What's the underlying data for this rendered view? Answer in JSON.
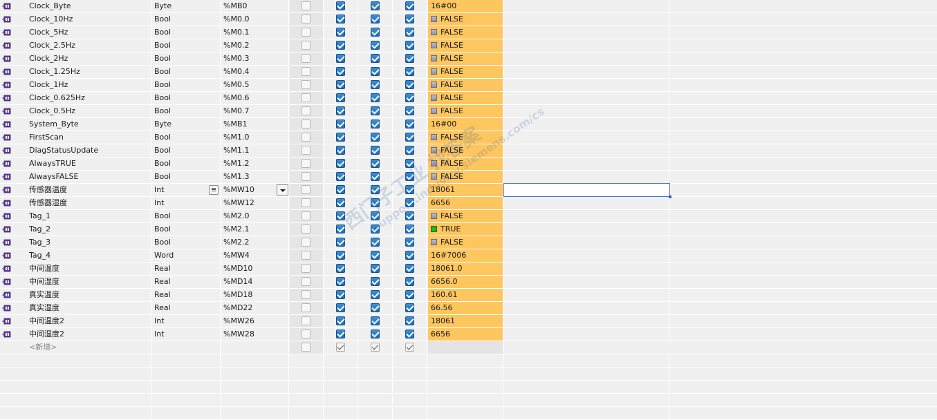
{
  "rows": [
    {
      "name": "Clock_Byte",
      "type": "Byte",
      "address": "%MB0",
      "monitor": "16#00",
      "bool": null
    },
    {
      "name": "Clock_10Hz",
      "type": "Bool",
      "address": "%M0.0",
      "monitor": "FALSE",
      "bool": "false"
    },
    {
      "name": "Clock_5Hz",
      "type": "Bool",
      "address": "%M0.1",
      "monitor": "FALSE",
      "bool": "false"
    },
    {
      "name": "Clock_2.5Hz",
      "type": "Bool",
      "address": "%M0.2",
      "monitor": "FALSE",
      "bool": "false"
    },
    {
      "name": "Clock_2Hz",
      "type": "Bool",
      "address": "%M0.3",
      "monitor": "FALSE",
      "bool": "false"
    },
    {
      "name": "Clock_1.25Hz",
      "type": "Bool",
      "address": "%M0.4",
      "monitor": "FALSE",
      "bool": "false"
    },
    {
      "name": "Clock_1Hz",
      "type": "Bool",
      "address": "%M0.5",
      "monitor": "FALSE",
      "bool": "false"
    },
    {
      "name": "Clock_0.625Hz",
      "type": "Bool",
      "address": "%M0.6",
      "monitor": "FALSE",
      "bool": "false"
    },
    {
      "name": "Clock_0.5Hz",
      "type": "Bool",
      "address": "%M0.7",
      "monitor": "FALSE",
      "bool": "false"
    },
    {
      "name": "System_Byte",
      "type": "Byte",
      "address": "%MB1",
      "monitor": "16#00",
      "bool": null
    },
    {
      "name": "FirstScan",
      "type": "Bool",
      "address": "%M1.0",
      "monitor": "FALSE",
      "bool": "false"
    },
    {
      "name": "DiagStatusUpdate",
      "type": "Bool",
      "address": "%M1.1",
      "monitor": "FALSE",
      "bool": "false"
    },
    {
      "name": "AlwaysTRUE",
      "type": "Bool",
      "address": "%M1.2",
      "monitor": "FALSE",
      "bool": "false"
    },
    {
      "name": "AlwaysFALSE",
      "type": "Bool",
      "address": "%M1.3",
      "monitor": "FALSE",
      "bool": "false"
    },
    {
      "name": "传感器温度",
      "type": "Int",
      "address": "%MW10",
      "monitor": "18061",
      "bool": null
    },
    {
      "name": "传感器湿度",
      "type": "Int",
      "address": "%MW12",
      "monitor": "6656",
      "bool": null
    },
    {
      "name": "Tag_1",
      "type": "Bool",
      "address": "%M2.0",
      "monitor": "FALSE",
      "bool": "false"
    },
    {
      "name": "Tag_2",
      "type": "Bool",
      "address": "%M2.1",
      "monitor": "TRUE",
      "bool": "true"
    },
    {
      "name": "Tag_3",
      "type": "Bool",
      "address": "%M2.2",
      "monitor": "FALSE",
      "bool": "false"
    },
    {
      "name": "Tag_4",
      "type": "Word",
      "address": "%MW4",
      "monitor": "16#7006",
      "bool": null
    },
    {
      "name": "中间温度",
      "type": "Real",
      "address": "%MD10",
      "monitor": "18061.0",
      "bool": null
    },
    {
      "name": "中间湿度",
      "type": "Real",
      "address": "%MD14",
      "monitor": "6656.0",
      "bool": null
    },
    {
      "name": "真实温度",
      "type": "Real",
      "address": "%MD18",
      "monitor": "160.61",
      "bool": null
    },
    {
      "name": "真实湿度",
      "type": "Real",
      "address": "%MD22",
      "monitor": "66.56",
      "bool": null
    },
    {
      "name": "中间温度2",
      "type": "Int",
      "address": "%MW26",
      "monitor": "18061",
      "bool": null
    },
    {
      "name": "中间湿度2",
      "type": "Int",
      "address": "%MW28",
      "monitor": "6656",
      "bool": null
    }
  ],
  "add_row": {
    "label": "<新增>"
  },
  "selected_row_index": 14,
  "colors": {
    "monitor_bg": "#fec65e",
    "checkbox_blue": "#1c6db8",
    "true_green": "#27b327",
    "selection_border": "#4a74d4"
  },
  "watermark": {
    "text_cn": "西门子工业 找答案",
    "text_url": "support.industry.siemens.com/cs"
  }
}
